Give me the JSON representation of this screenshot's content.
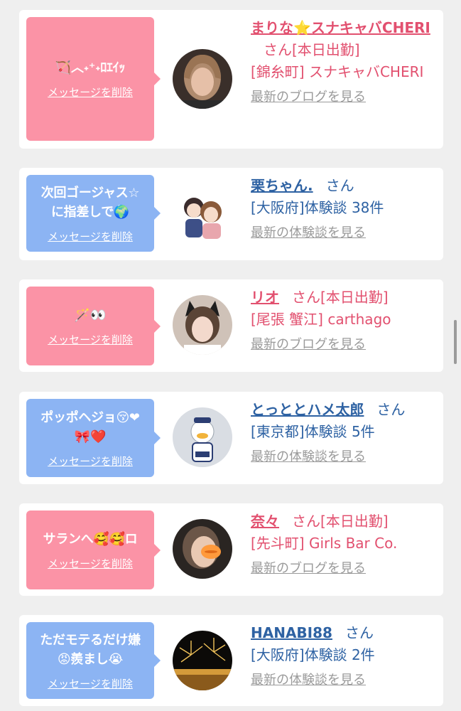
{
  "cards": [
    {
      "type": "cast",
      "message": "🏹︿˖⁺˖ﾛｴｲｯ",
      "delete_label": "メッセージを削除",
      "name": "まりな⭐スナキャバCHERI",
      "suffix": "さん[本日出勤]",
      "detail": "[錦糸町] スナキャバCHERI",
      "link_label": "最新のブログを見る",
      "avatar_icon": "woman-photo"
    },
    {
      "type": "user",
      "message": "次回ゴージャス☆\nに指差しで🌍",
      "delete_label": "メッセージを削除",
      "name": "栗ちゃん.",
      "suffix": "さん",
      "detail": "[大阪府]体験談 38件",
      "link_label": "最新の体験談を見る",
      "avatar_icon": "couple-illustration"
    },
    {
      "type": "cast",
      "message": "🪄👀",
      "delete_label": "メッセージを削除",
      "name": "リオ",
      "suffix": "さん[本日出勤]",
      "detail": "[尾張 蟹江] carthago",
      "link_label": "最新のブログを見る",
      "avatar_icon": "cat-ears-girl-photo"
    },
    {
      "type": "user",
      "message": "ポッポヘジョ😚❤\n🎀❤️",
      "delete_label": "メッセージを削除",
      "name": "とっととハメ太郎",
      "suffix": "さん",
      "detail": "[東京都]体験談 5件",
      "link_label": "最新の体験談を見る",
      "avatar_icon": "duck-mascot"
    },
    {
      "type": "cast",
      "message": "サランへ🥰🥰ロ",
      "delete_label": "メッセージを削除",
      "name": "奈々",
      "suffix": "さん[本日出勤]",
      "detail": "[先斗町] Girls Bar Co.",
      "link_label": "最新のブログを見る",
      "avatar_icon": "woman-lips-photo"
    },
    {
      "type": "user",
      "message": "ただモテるだけ嫌\n😡羨まし😭",
      "delete_label": "メッセージを削除",
      "name": "HANABI88",
      "suffix": "さん",
      "detail": "[大阪府]体験談 2件",
      "link_label": "最新の体験談を見る",
      "avatar_icon": "fireworks-photo"
    }
  ],
  "colors": {
    "cast_accent": "#e2506f",
    "user_accent": "#2e62a3",
    "cast_bubble": "#fb93a6",
    "user_bubble": "#8cb4f3"
  }
}
